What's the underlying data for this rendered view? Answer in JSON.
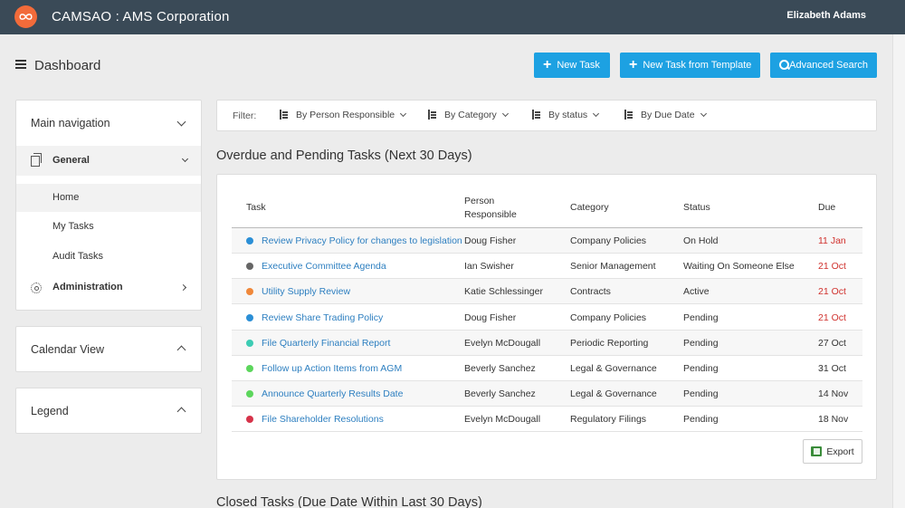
{
  "topbar": {
    "app_title": "CAMSAO : AMS Corporation",
    "user_name": "Elizabeth Adams"
  },
  "header": {
    "title": "Dashboard",
    "buttons": {
      "new_task": "New Task",
      "new_task_template": "New Task from Template",
      "advanced_search": "Advanced Search"
    }
  },
  "sidebar": {
    "main_nav_title": "Main navigation",
    "items": [
      {
        "label": "General"
      },
      {
        "label": "Home"
      },
      {
        "label": "My Tasks"
      },
      {
        "label": "Audit Tasks"
      },
      {
        "label": "Administration"
      }
    ],
    "calendar_title": "Calendar View",
    "legend_title": "Legend"
  },
  "filters": {
    "label": "Filter:",
    "options": [
      "By Person Responsible",
      "By Category",
      "By status",
      "By Due Date"
    ]
  },
  "overdue_section": {
    "title": "Overdue and Pending Tasks (Next 30 Days)",
    "columns": {
      "task": "Task",
      "person_line1": "Person",
      "person_line2": "Responsible",
      "category": "Category",
      "status": "Status",
      "due": "Due"
    },
    "rows": [
      {
        "task": "Review Privacy Policy for changes to legislation",
        "person": "Doug Fisher",
        "category": "Company Policies",
        "status": "On Hold",
        "due": "11 Jan",
        "dot": "#2b8fd6",
        "overdue": true
      },
      {
        "task": "Executive Committee Agenda",
        "person": "Ian Swisher",
        "category": "Senior Management",
        "status": "Waiting On Someone Else",
        "due": "21 Oct",
        "dot": "#666666",
        "overdue": true
      },
      {
        "task": "Utility Supply Review",
        "person": "Katie Schlessinger",
        "category": "Contracts",
        "status": "Active",
        "due": "21 Oct",
        "dot": "#f0883a",
        "overdue": true
      },
      {
        "task": "Review Share Trading Policy",
        "person": "Doug Fisher",
        "category": "Company Policies",
        "status": "Pending",
        "due": "21 Oct",
        "dot": "#2b8fd6",
        "overdue": true
      },
      {
        "task": "File Quarterly Financial Report",
        "person": "Evelyn McDougall",
        "category": "Periodic Reporting",
        "status": "Pending",
        "due": "27 Oct",
        "dot": "#3dccb4",
        "overdue": false
      },
      {
        "task": "Follow up Action Items from AGM",
        "person": "Beverly Sanchez",
        "category": "Legal & Governance",
        "status": "Pending",
        "due": "31 Oct",
        "dot": "#5cd65c",
        "overdue": false
      },
      {
        "task": "Announce Quarterly Results Date",
        "person": "Beverly Sanchez",
        "category": "Legal & Governance",
        "status": "Pending",
        "due": "14 Nov",
        "dot": "#5cd65c",
        "overdue": false
      },
      {
        "task": "File Shareholder Resolutions",
        "person": "Evelyn McDougall",
        "category": "Regulatory Filings",
        "status": "Pending",
        "due": "18 Nov",
        "dot": "#d6334a",
        "overdue": false
      }
    ],
    "export_label": "Export"
  },
  "closed_section": {
    "title": "Closed Tasks (Due Date Within Last 30 Days)"
  }
}
